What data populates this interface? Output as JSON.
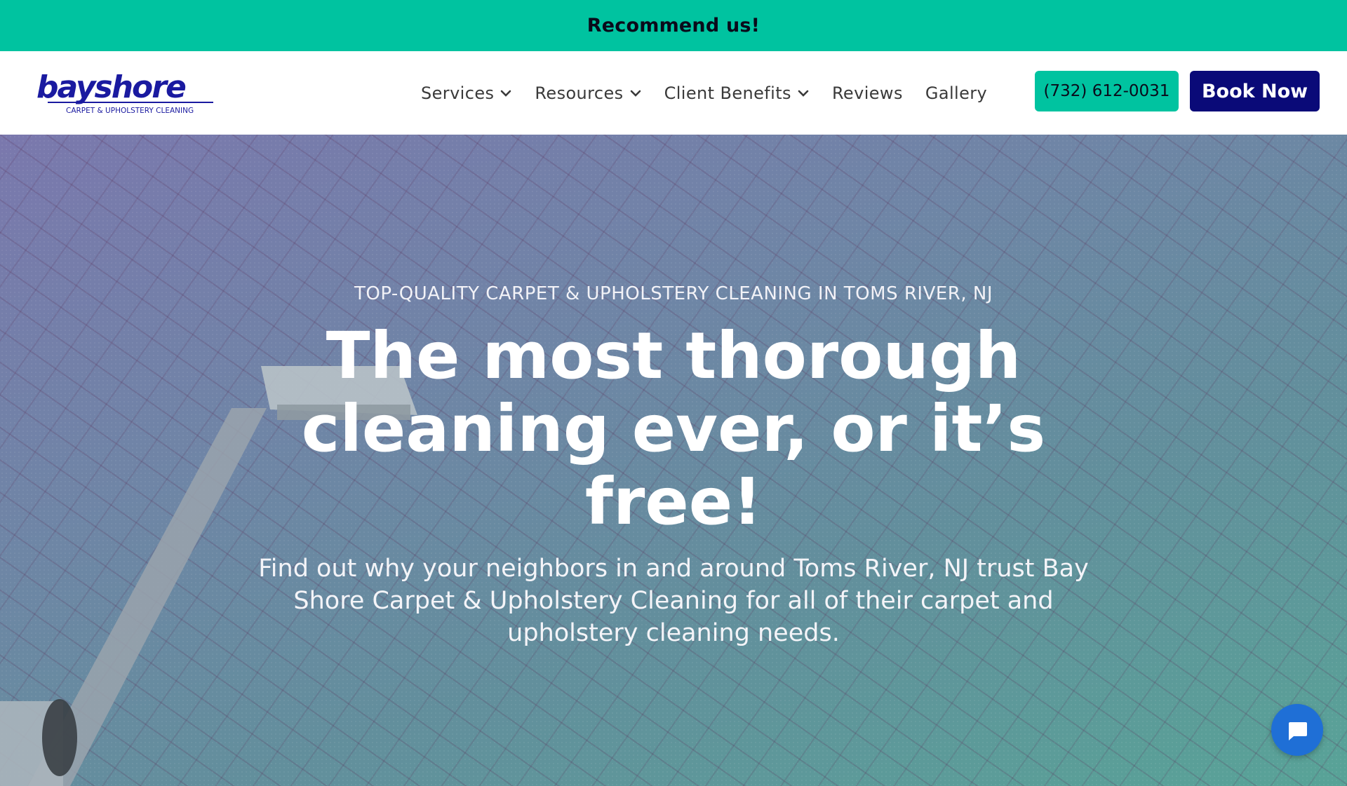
{
  "promo": {
    "text": "Recommend us!"
  },
  "header": {
    "logo": {
      "name": "bayshore",
      "tagline": "CARPET & UPHOLSTERY CLEANING"
    },
    "nav": [
      {
        "label": "Services",
        "has_dropdown": true
      },
      {
        "label": "Resources",
        "has_dropdown": true
      },
      {
        "label": "Client Benefits",
        "has_dropdown": true
      },
      {
        "label": "Reviews",
        "has_dropdown": false
      },
      {
        "label": "Gallery",
        "has_dropdown": false
      }
    ],
    "phone_label": "(732) 612-0031",
    "book_label": "Book Now"
  },
  "hero": {
    "eyebrow": "TOP-QUALITY CARPET & UPHOLSTERY CLEANING IN TOMS RIVER, NJ",
    "title": "The most thorough cleaning ever, or it’s free!",
    "subtitle": "Find out why your neighbors in and around Toms River, NJ trust Bay Shore Carpet & Upholstery Cleaning for all of their carpet and upholstery cleaning needs."
  },
  "chat": {
    "icon": "chat-bubble-icon"
  },
  "colors": {
    "accent": "#00c3a0",
    "brand_navy": "#0a0a78",
    "chat_blue": "#1f6fd6"
  }
}
